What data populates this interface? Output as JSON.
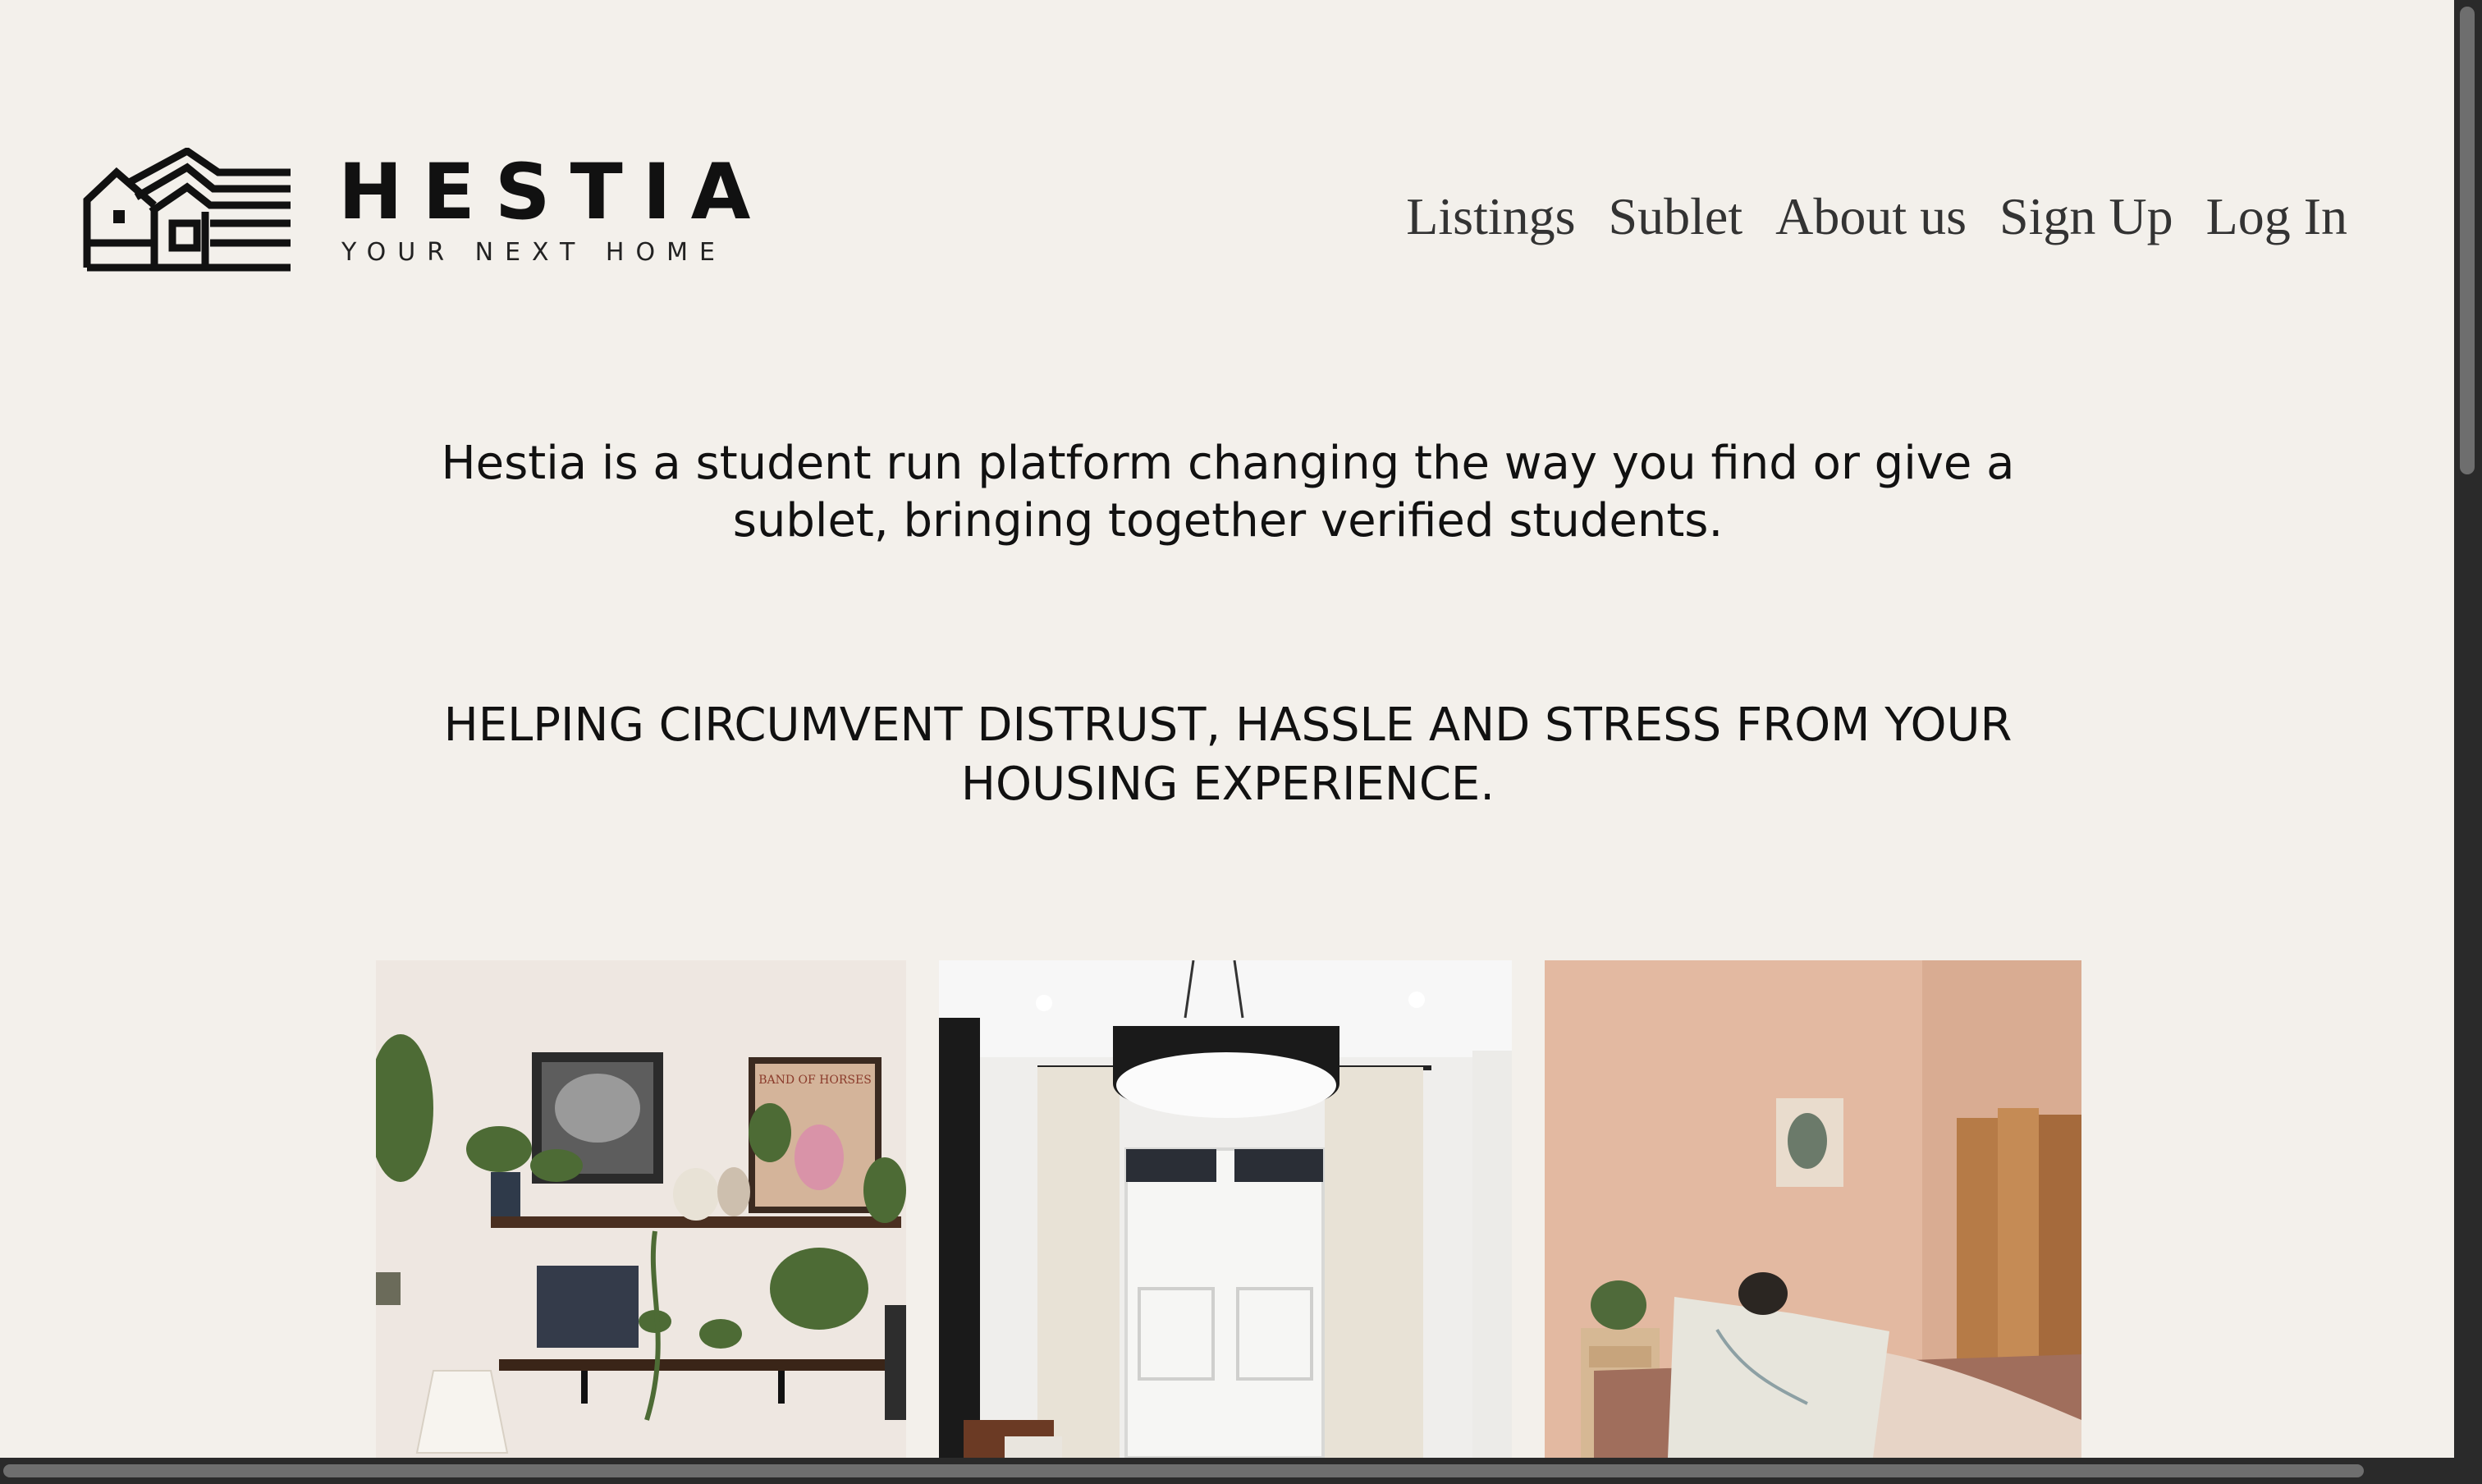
{
  "brand": {
    "name": "HESTIA",
    "tagline": "YOUR NEXT HOME"
  },
  "nav": {
    "items": [
      {
        "label": "Listings"
      },
      {
        "label": "Sublet"
      },
      {
        "label": "About us"
      },
      {
        "label": "Sign Up"
      },
      {
        "label": "Log In"
      }
    ]
  },
  "main": {
    "intro": "Hestia is a student run platform changing the way you find or give a sublet, bringing together verified students.",
    "tagline": "HELPING CIRCUMVENT DISTRUST, HASSLE AND STRESS FROM YOUR HOUSING EXPERIENCE."
  },
  "gallery": {
    "photos": [
      {
        "icon": "room-shelves-plants-photo",
        "poster_text": "BAND OF HORSES"
      },
      {
        "icon": "room-pendant-lamp-photo"
      },
      {
        "icon": "bedroom-map-reading-photo"
      }
    ]
  },
  "colors": {
    "background": "#f3f0eb",
    "text": "#111111",
    "nav_text": "#333333",
    "scrollbar": "#2a2a2a"
  }
}
